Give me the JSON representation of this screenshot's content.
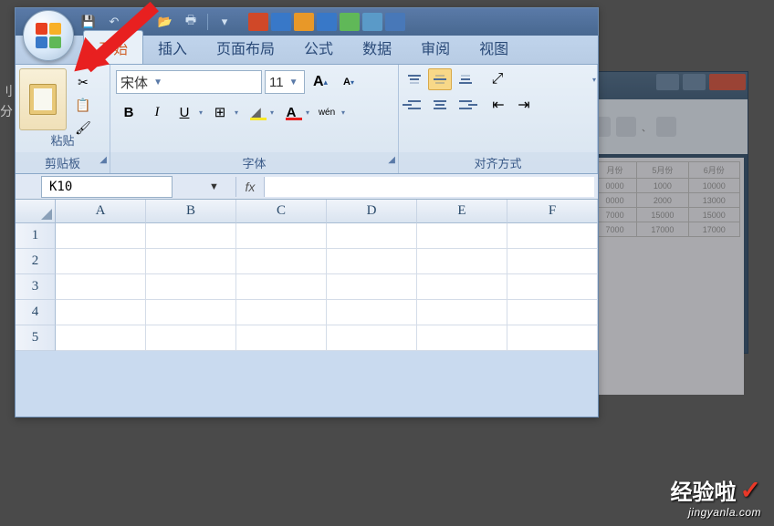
{
  "edge": {
    "t1": "刂",
    "t2": "分"
  },
  "qat": {
    "save": "💾",
    "undo": "↶",
    "redo": "↷",
    "open": "📂",
    "print": "🖶"
  },
  "accents": [
    "#d04828",
    "#3878c8",
    "#e89828",
    "#3878c8",
    "#60b858",
    "#5a9ac8",
    "#4878b8"
  ],
  "tabs": [
    "开始",
    "插入",
    "页面布局",
    "公式",
    "数据",
    "审阅",
    "视图"
  ],
  "clipboard": {
    "paste": "粘贴",
    "cut": "✂",
    "copy": "📋",
    "format": "🖌",
    "label": "剪贴板"
  },
  "font": {
    "name": "宋体",
    "size": "11",
    "growA": "A",
    "shrinkA": "A",
    "bold": "B",
    "italic": "I",
    "underline": "U",
    "border": "⊞",
    "fill": "◢",
    "color": "A",
    "phonetic": "wén",
    "label": "字体"
  },
  "align": {
    "label": "对齐方式",
    "wrap": "↵",
    "merge": "⊟"
  },
  "namebox": "K10",
  "fx": "fx",
  "columns": [
    "A",
    "B",
    "C",
    "D",
    "E",
    "F"
  ],
  "rows": [
    "1",
    "2",
    "3",
    "4",
    "5"
  ],
  "bg": {
    "headers": [
      "月份",
      "5月份",
      "6月份"
    ],
    "data": [
      [
        "0000",
        "1000",
        "10000"
      ],
      [
        "0000",
        "2000",
        "13000"
      ],
      [
        "7000",
        "15000",
        "15000"
      ],
      [
        "7000",
        "17000",
        "17000"
      ]
    ]
  },
  "watermark": {
    "main": "经验啦",
    "check": "✓",
    "sub": "jingyanla.com"
  }
}
